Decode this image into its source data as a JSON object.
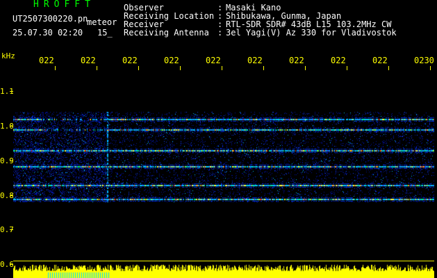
{
  "header": {
    "app_name": "HROFFT",
    "file_name": "UT2507300220.pn",
    "file_type": "meteor",
    "date_time": "25.07.30 02:20",
    "interval": "15_"
  },
  "station": {
    "rows": [
      {
        "label": "Observer",
        "value": "Masaki Kano"
      },
      {
        "label": "Receiving Location",
        "value": "Shibukawa, Gunma, Japan"
      },
      {
        "label": "Receiver",
        "value": "RTL-SDR SDR# 43dB L15 103.2MHz CW"
      },
      {
        "label": "Receiving Antenna",
        "value": "3el Yagi(V) Az 330 for Vladivostok"
      }
    ],
    "separator": ":"
  },
  "x_axis": {
    "tick_labels": [
      "022",
      "022",
      "022",
      "022",
      "022",
      "022",
      "022",
      "022",
      "022",
      "0230"
    ]
  },
  "y_axis": {
    "unit": "kHz",
    "tick_labels": [
      "1.1",
      "1.0",
      "0.9",
      "0.8",
      "0.7",
      "0.6"
    ]
  },
  "colors": {
    "background": "#000000",
    "text_white": "#ffffff",
    "text_yellow": "#ffff00",
    "title_green": "#00ff00",
    "noise_blue": "#0018a8",
    "signal_cyan": "#00c8ff",
    "signal_yellow": "#ffff00",
    "signal_red": "#ff2000",
    "spectrum_yellow": "#ffff00",
    "spectrum_cyan": "#00e0ff"
  },
  "waterfall": {
    "carrier_frequencies_khz": [
      1.02,
      0.99,
      0.93,
      0.885,
      0.83,
      0.79
    ]
  }
}
